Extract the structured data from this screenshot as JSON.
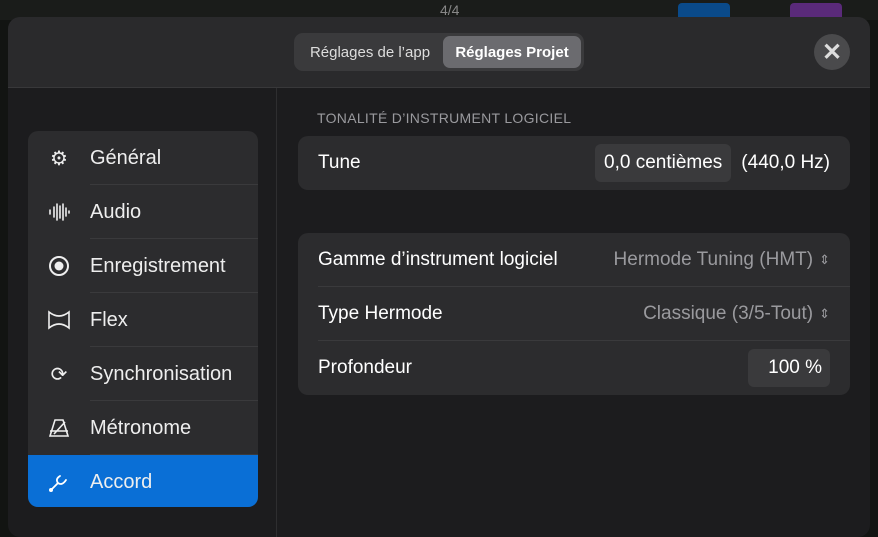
{
  "header": {
    "tabs": [
      {
        "label": "Réglages de l’app",
        "selected": false
      },
      {
        "label": "Réglages Projet",
        "selected": true
      }
    ],
    "close_icon": "xmark",
    "background_time_signature": "4/4"
  },
  "sidebar": {
    "items": [
      {
        "label": "Général",
        "icon": "gear"
      },
      {
        "label": "Audio",
        "icon": "waveform"
      },
      {
        "label": "Enregistrement",
        "icon": "record-circle"
      },
      {
        "label": "Flex",
        "icon": "flex"
      },
      {
        "label": "Synchronisation",
        "icon": "sync-arrows"
      },
      {
        "label": "Métronome",
        "icon": "metronome"
      },
      {
        "label": "Accord",
        "icon": "tuning-fork",
        "selected": true
      }
    ]
  },
  "main": {
    "section_title": "TONALITÉ D’INSTRUMENT LOGICIEL",
    "tune": {
      "label": "Tune",
      "value": "0,0 centièmes",
      "hz": "(440,0 Hz)"
    },
    "scale": {
      "label": "Gamme d’instrument logiciel",
      "value": "Hermode Tuning (HMT)"
    },
    "hermode": {
      "label": "Type Hermode",
      "value": "Classique (3/5-Tout)"
    },
    "depth": {
      "label": "Profondeur",
      "value": "100 %"
    }
  },
  "colors": {
    "accent": "#0a6fd6"
  }
}
